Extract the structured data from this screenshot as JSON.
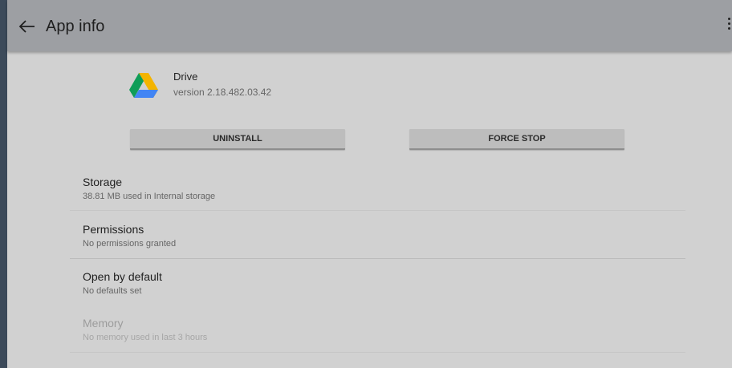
{
  "toolbar": {
    "title": "App info",
    "back_icon": "arrow-left-icon",
    "menu_icon": "more-vert-icon"
  },
  "app": {
    "name": "Drive",
    "version": "version 2.18.482.03.42",
    "icon": "google-drive-icon",
    "icon_colors": {
      "green": "#0F9D58",
      "yellow": "#F4B400",
      "blue": "#4285F4"
    }
  },
  "buttons": {
    "uninstall": "UNINSTALL",
    "force_stop": "FORCE STOP"
  },
  "preferences": [
    {
      "title": "Storage",
      "summary": "38.81 MB used in Internal storage",
      "enabled": true
    },
    {
      "title": "Permissions",
      "summary": "No permissions granted",
      "enabled": true
    },
    {
      "title": "Open by default",
      "summary": "No defaults set",
      "enabled": true
    },
    {
      "title": "Memory",
      "summary": "No memory used in last 3 hours",
      "enabled": false
    }
  ],
  "colors": {
    "toolbar": "#9d9fa3",
    "background": "#d1d1d1",
    "button": "#bdbdbd"
  }
}
